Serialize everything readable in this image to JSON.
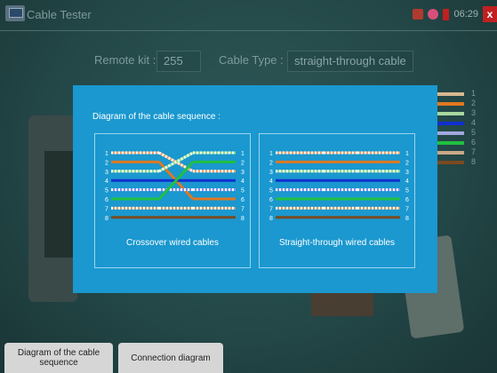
{
  "app": {
    "title": "Cable Tester",
    "time": "06:29"
  },
  "status_icons": [
    {
      "name": "record-icon",
      "color": "#c0392b"
    },
    {
      "name": "link-icon",
      "color": "#e0567a"
    },
    {
      "name": "battery-icon",
      "color": "#c02020"
    }
  ],
  "remote_kit": {
    "label": "Remote kit :",
    "value": "255"
  },
  "cable_type": {
    "label": "Cable Type :",
    "value": "straight-through cable"
  },
  "modal": {
    "title": "Diagram of the cable sequence :",
    "panels": [
      {
        "caption": "Crossover wired cables",
        "pin_numbers": [
          "1",
          "2",
          "3",
          "4",
          "5",
          "6",
          "7",
          "8"
        ]
      },
      {
        "caption": "Straight-through wired cables",
        "pin_numbers": [
          "1",
          "2",
          "3",
          "4",
          "5",
          "6",
          "7",
          "8"
        ]
      }
    ]
  },
  "background_pins": [
    "1",
    "2",
    "3",
    "4",
    "5",
    "6",
    "7",
    "8"
  ],
  "wire_colors": {
    "white_orange": "#f2a36a",
    "orange": "#e07820",
    "white_green": "#8fe08a",
    "blue": "#1030d0",
    "white_blue": "#8090f0",
    "green": "#20c040",
    "white_brown": "#c8a070",
    "brown": "#7a4a20"
  },
  "bottom_buttons": [
    {
      "label": "Diagram of the cable sequence"
    },
    {
      "label": "Connection diagram"
    }
  ]
}
